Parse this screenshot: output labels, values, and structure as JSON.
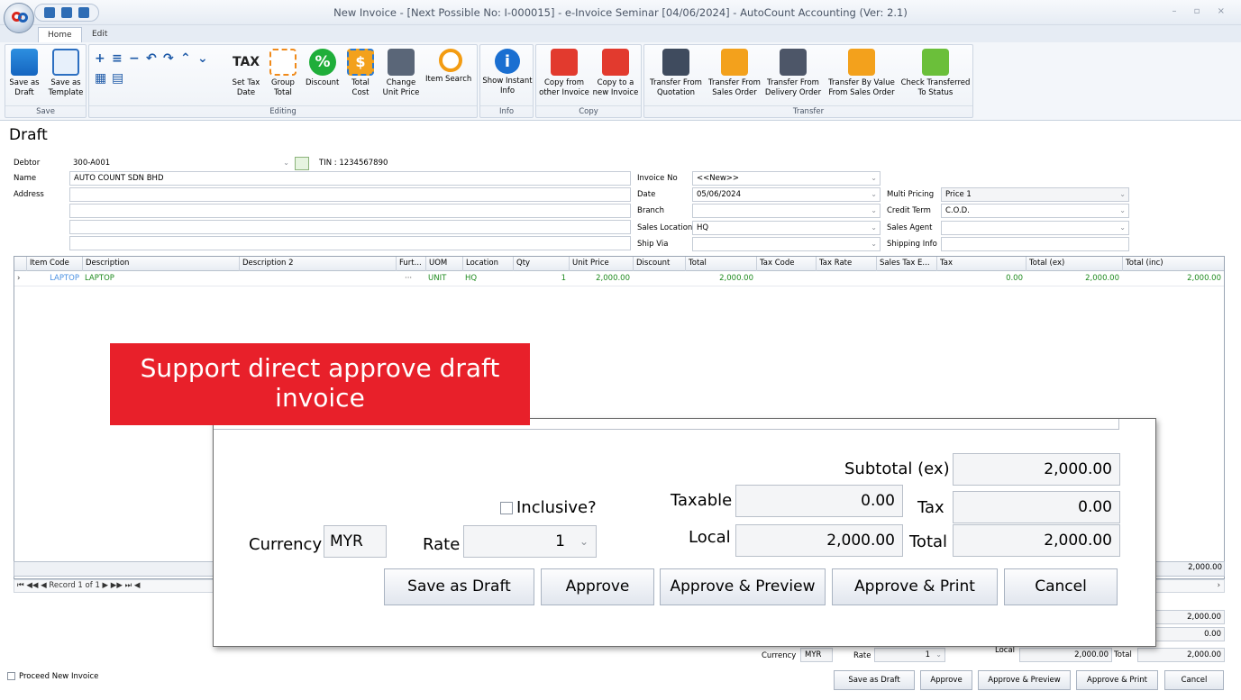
{
  "titlebar": {
    "title": "New Invoice - [Next Possible No: I-000015] - e-Invoice Seminar [04/06/2024] - AutoCount Accounting (Ver: 2.1)",
    "controls": "– ▫ ×"
  },
  "tabs": {
    "home": "Home",
    "edit": "Edit"
  },
  "ribbon": {
    "save_as_draft": "Save as Draft",
    "save_as_template": "Save as Template",
    "group_save": "Save",
    "set_tax_date": "Set Tax Date",
    "group_total": "Group Total",
    "discount": "Discount",
    "total_cost": "Total Cost",
    "change_unit_price": "Change Unit Price",
    "item_search": "Item Search",
    "group_editing": "Editing",
    "show_instant_info": "Show Instant Info",
    "group_info": "Info",
    "copy_from_other": "Copy from other Invoice",
    "copy_to_new": "Copy to a new Invoice",
    "group_copy": "Copy",
    "transfer_quotation": "Transfer From Quotation",
    "transfer_sales_order": "Transfer From Sales Order",
    "transfer_delivery_order": "Transfer From Delivery Order",
    "transfer_by_value": "Transfer By Value From Sales Order",
    "check_transferred": "Check Transferred To Status",
    "group_transfer": "Transfer"
  },
  "page_title": "Draft",
  "header": {
    "debtor_label": "Debtor",
    "debtor_value": "300-A001",
    "tin": "TIN : 1234567890",
    "name_label": "Name",
    "name_value": "AUTO COUNT SDN BHD",
    "address_label": "Address",
    "invoice_no_label": "Invoice No",
    "invoice_no_value": "<<New>>",
    "date_label": "Date",
    "date_value": "05/06/2024",
    "branch_label": "Branch",
    "branch_value": "",
    "sales_location_label": "Sales Location",
    "sales_location_value": "HQ",
    "ship_via_label": "Ship Via",
    "ship_via_value": "",
    "multi_pricing_label": "Multi Pricing",
    "multi_pricing_value": "Price 1",
    "credit_term_label": "Credit Term",
    "credit_term_value": "C.O.D.",
    "sales_agent_label": "Sales Agent",
    "sales_agent_value": "",
    "shipping_info_label": "Shipping Info",
    "shipping_info_value": ""
  },
  "grid": {
    "columns": [
      "Item Code",
      "Description",
      "Description 2",
      "Furt...",
      "UOM",
      "Location",
      "Qty",
      "Unit Price",
      "Discount",
      "Total",
      "Tax Code",
      "Tax Rate",
      "Sales Tax E...",
      "Tax",
      "Total (ex)",
      "Total (inc)"
    ],
    "row": {
      "item_code": "LAPTOP",
      "description": "LAPTOP",
      "description2": "",
      "further": "···",
      "uom": "UNIT",
      "location": "HQ",
      "qty": "1",
      "unit_price": "2,000.00",
      "discount": "",
      "total": "2,000.00",
      "tax_code": "",
      "tax_rate": "",
      "sales_tax_e": "",
      "tax": "0.00",
      "total_ex": "2,000.00",
      "total_inc": "2,000.00"
    },
    "footer_total": "2,000.00",
    "record_nav": "⏮ ◀◀ ◀  Record 1 of 1  ▶ ▶▶ ⏭  ◀"
  },
  "summary": {
    "subtotal": "2,000.00",
    "tax": "0.00",
    "currency_label": "Currency",
    "currency": "MYR",
    "rate_label": "Rate",
    "rate": "1",
    "local_label": "Local",
    "local": "2,000.00",
    "total_label": "Total",
    "total": "2,000.00"
  },
  "buttons": {
    "save_as_draft": "Save as Draft",
    "approve": "Approve",
    "approve_preview": "Approve & Preview",
    "approve_print": "Approve & Print",
    "cancel": "Cancel"
  },
  "proceed_new": "Proceed New Invoice",
  "banner": "Support direct approve draft invoice",
  "zoom": {
    "subtotal_label": "Subtotal (ex)",
    "subtotal": "2,000.00",
    "inclusive_label": "Inclusive?",
    "taxable_label": "Taxable",
    "taxable": "0.00",
    "tax_label": "Tax",
    "tax": "0.00",
    "currency_label": "Currency",
    "currency": "MYR",
    "rate_label": "Rate",
    "rate": "1",
    "local_label": "Local",
    "local": "2,000.00",
    "total_label": "Total",
    "total": "2,000.00"
  }
}
